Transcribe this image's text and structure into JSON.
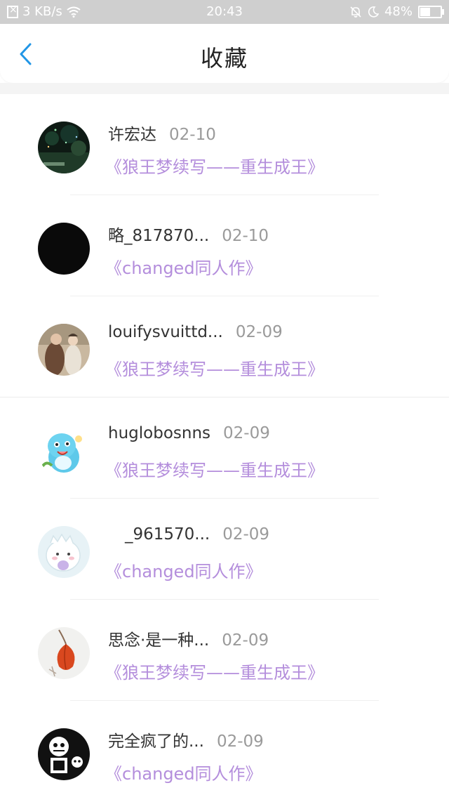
{
  "status_bar": {
    "network_speed": "3 KB/s",
    "time": "20:43",
    "battery": "48%",
    "icons": [
      "no-sim-icon",
      "wifi-icon",
      "bell-off-icon",
      "moon-icon",
      "battery-icon"
    ],
    "battery_level": 0.48
  },
  "header": {
    "title": "收藏",
    "back_icon": "chevron-left-icon",
    "accent_color": "#2196e6"
  },
  "colors": {
    "work_title": "#b48edc",
    "date": "#9a9a9a",
    "name": "#333333"
  },
  "items": [
    {
      "name": "许宏达",
      "date": "02-10",
      "work": "《狼王梦续写——重生成王》",
      "avatar": "forest-night-avatar"
    },
    {
      "name": "略_817870...",
      "date": "02-10",
      "work": "《changed同人作》",
      "avatar": "black-avatar"
    },
    {
      "name": "louifysvuittd...",
      "date": "02-09",
      "work": "《狼王梦续写——重生成王》",
      "avatar": "photo-couple-avatar"
    },
    {
      "name": "huglobosnns",
      "date": "02-09",
      "work": "《狼王梦续写——重生成王》",
      "avatar": "cartoon-dino-avatar"
    },
    {
      "name": "_961570...",
      "date": "02-09",
      "work": "《changed同人作》",
      "avatar": "white-dino-avatar"
    },
    {
      "name": "思念·是一种...",
      "date": "02-09",
      "work": "《狼王梦续写——重生成王》",
      "avatar": "lantern-plant-avatar"
    },
    {
      "name": "完全疯了的...",
      "date": "02-09",
      "work": "《changed同人作》",
      "avatar": "skeleton-cartoon-avatar"
    }
  ]
}
